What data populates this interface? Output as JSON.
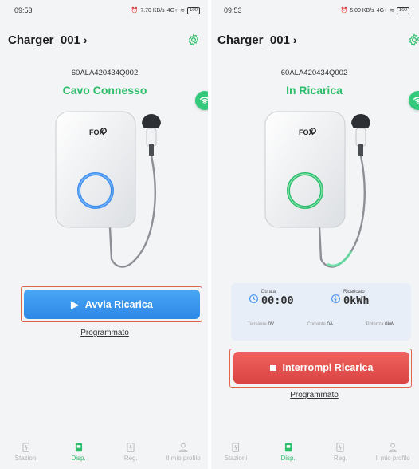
{
  "colors": {
    "accent_green": "#2ebd6a",
    "start_blue": "#2c88e6",
    "stop_red": "#d94442",
    "highlight": "#e2664a"
  },
  "screens": [
    {
      "status_time": "09:53",
      "status_speed": "7.70 KB/s",
      "status_net": "4G+",
      "battery": "100",
      "title": "Charger_001",
      "serial": "60ALA420434Q002",
      "status_text": "Cavo Connesso",
      "brand": "FOX",
      "button_label": "Avvia Ricarica",
      "schedule_label": "Programmato",
      "ring_color": "#3d8ef0"
    },
    {
      "status_time": "09:53",
      "status_speed": "5.00 KB/s",
      "status_net": "4G+",
      "battery": "100",
      "title": "Charger_001",
      "serial": "60ALA420434Q002",
      "status_text": "In Ricarica",
      "brand": "FOX",
      "button_label": "Interrompi Ricarica",
      "schedule_label": "Programmato",
      "ring_color": "#2ebd6a",
      "stats": {
        "duration_label": "Durata",
        "duration_value": "00:00",
        "charged_label": "Ricaricato",
        "charged_value": "0kWh",
        "voltage_label": "Tensione",
        "voltage_value": "0V",
        "current_label": "Corrente",
        "current_value": "0A",
        "power_label": "Potenza",
        "power_value": "0kW"
      }
    }
  ],
  "tabs": [
    {
      "label": "Stazioni",
      "icon": "station-icon"
    },
    {
      "label": "Disp.",
      "icon": "device-icon"
    },
    {
      "label": "Reg.",
      "icon": "record-icon"
    },
    {
      "label": "Il mio profilo",
      "icon": "profile-icon"
    }
  ]
}
